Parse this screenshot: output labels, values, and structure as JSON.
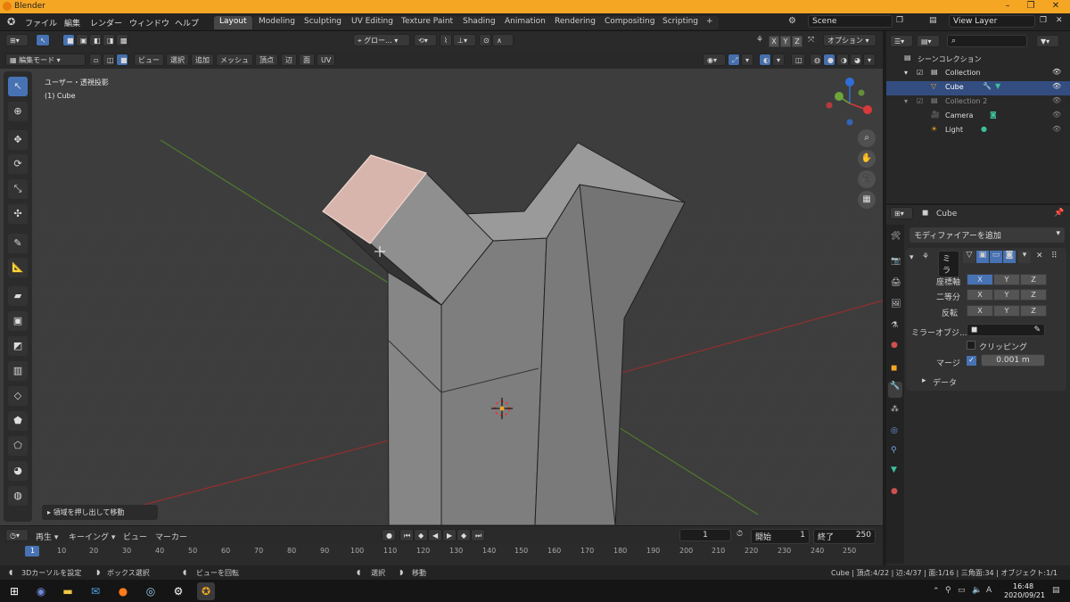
{
  "window": {
    "title": "Blender"
  },
  "menu": [
    "ファイル",
    "編集",
    "レンダー",
    "ウィンドウ",
    "ヘルプ"
  ],
  "workspaces": [
    "Layout",
    "Modeling",
    "Sculpting",
    "UV Editing",
    "Texture Paint",
    "Shading",
    "Animation",
    "Rendering",
    "Compositing",
    "Scripting"
  ],
  "active_workspace": "Layout",
  "scene": {
    "name": "Scene",
    "view_layer": "View Layer"
  },
  "viewport_header": {
    "mode": "編集モード",
    "menus": [
      "ビュー",
      "選択",
      "追加",
      "メッシュ",
      "頂点",
      "辺",
      "面",
      "UV"
    ],
    "transform": "グロー...",
    "axes": [
      "X",
      "Y",
      "Z"
    ],
    "options": "オプション"
  },
  "viewport": {
    "view_name": "ユーザー・透視投影",
    "object_info": "(1) Cube",
    "operator_panel": "領域を押し出して移動"
  },
  "outliner": {
    "title": "シーンコレクション",
    "items": [
      {
        "label": "Collection"
      },
      {
        "label": "Cube",
        "selected": true
      },
      {
        "label": "Collection 2"
      },
      {
        "label": "Camera"
      },
      {
        "label": "Light"
      }
    ]
  },
  "properties": {
    "object": "Cube",
    "add_modifier": "モディファイアーを追加",
    "modifier_name": "ミラ",
    "axis_label": "座標軸",
    "bisect_label": "二等分",
    "flip_label": "反転",
    "xyz": [
      "X",
      "Y",
      "Z"
    ],
    "mirror_object_label": "ミラーオブジ...",
    "clipping_label": "クリッピング",
    "merge_label": "マージ",
    "merge_value": "0.001 m",
    "data_label": "データ"
  },
  "timeline": {
    "menus": [
      "再生",
      "キーイング",
      "ビュー",
      "マーカー"
    ],
    "current_frame": "1",
    "start_label": "開始",
    "start": "1",
    "end_label": "終了",
    "end": "250",
    "frame_numbers": [
      "1",
      "10",
      "20",
      "30",
      "40",
      "50",
      "60",
      "70",
      "80",
      "90",
      "100",
      "110",
      "120",
      "130",
      "140",
      "150",
      "160",
      "170",
      "180",
      "190",
      "200",
      "210",
      "220",
      "230",
      "240",
      "250"
    ]
  },
  "statusbar": {
    "left": [
      "3Dカーソルを設定",
      "ボックス選択",
      "ビューを回転",
      "選択",
      "移動"
    ],
    "right": "Cube | 頂点:4/22 | 辺:4/37 | 面:1/16 | 三角面:34 | オブジェクト:1/1"
  },
  "taskbar": {
    "time": "16:48",
    "date": "2020/09/21"
  },
  "colors": {
    "accent": "#4772b3",
    "title_bar": "#f5a623",
    "selected_face": "#d8b5ac"
  }
}
